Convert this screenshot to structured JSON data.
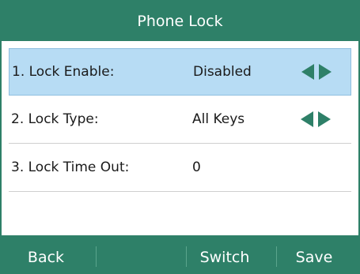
{
  "title": "Phone Lock",
  "rows": [
    {
      "label": "1. Lock Enable:",
      "value": "Disabled",
      "selected": true,
      "has_arrows": true
    },
    {
      "label": "2. Lock Type:",
      "value": "All Keys",
      "selected": false,
      "has_arrows": true
    },
    {
      "label": "3. Lock Time Out:",
      "value": "0",
      "selected": false,
      "has_arrows": false
    }
  ],
  "softkeys": [
    "Back",
    "",
    "Switch",
    "Save"
  ],
  "colors": {
    "header_bg": "#2e8068",
    "selected_row_bg": "#b7dcf4",
    "arrow": "#2e8068"
  },
  "icons": [
    "arrow-left-icon",
    "arrow-right-icon"
  ]
}
